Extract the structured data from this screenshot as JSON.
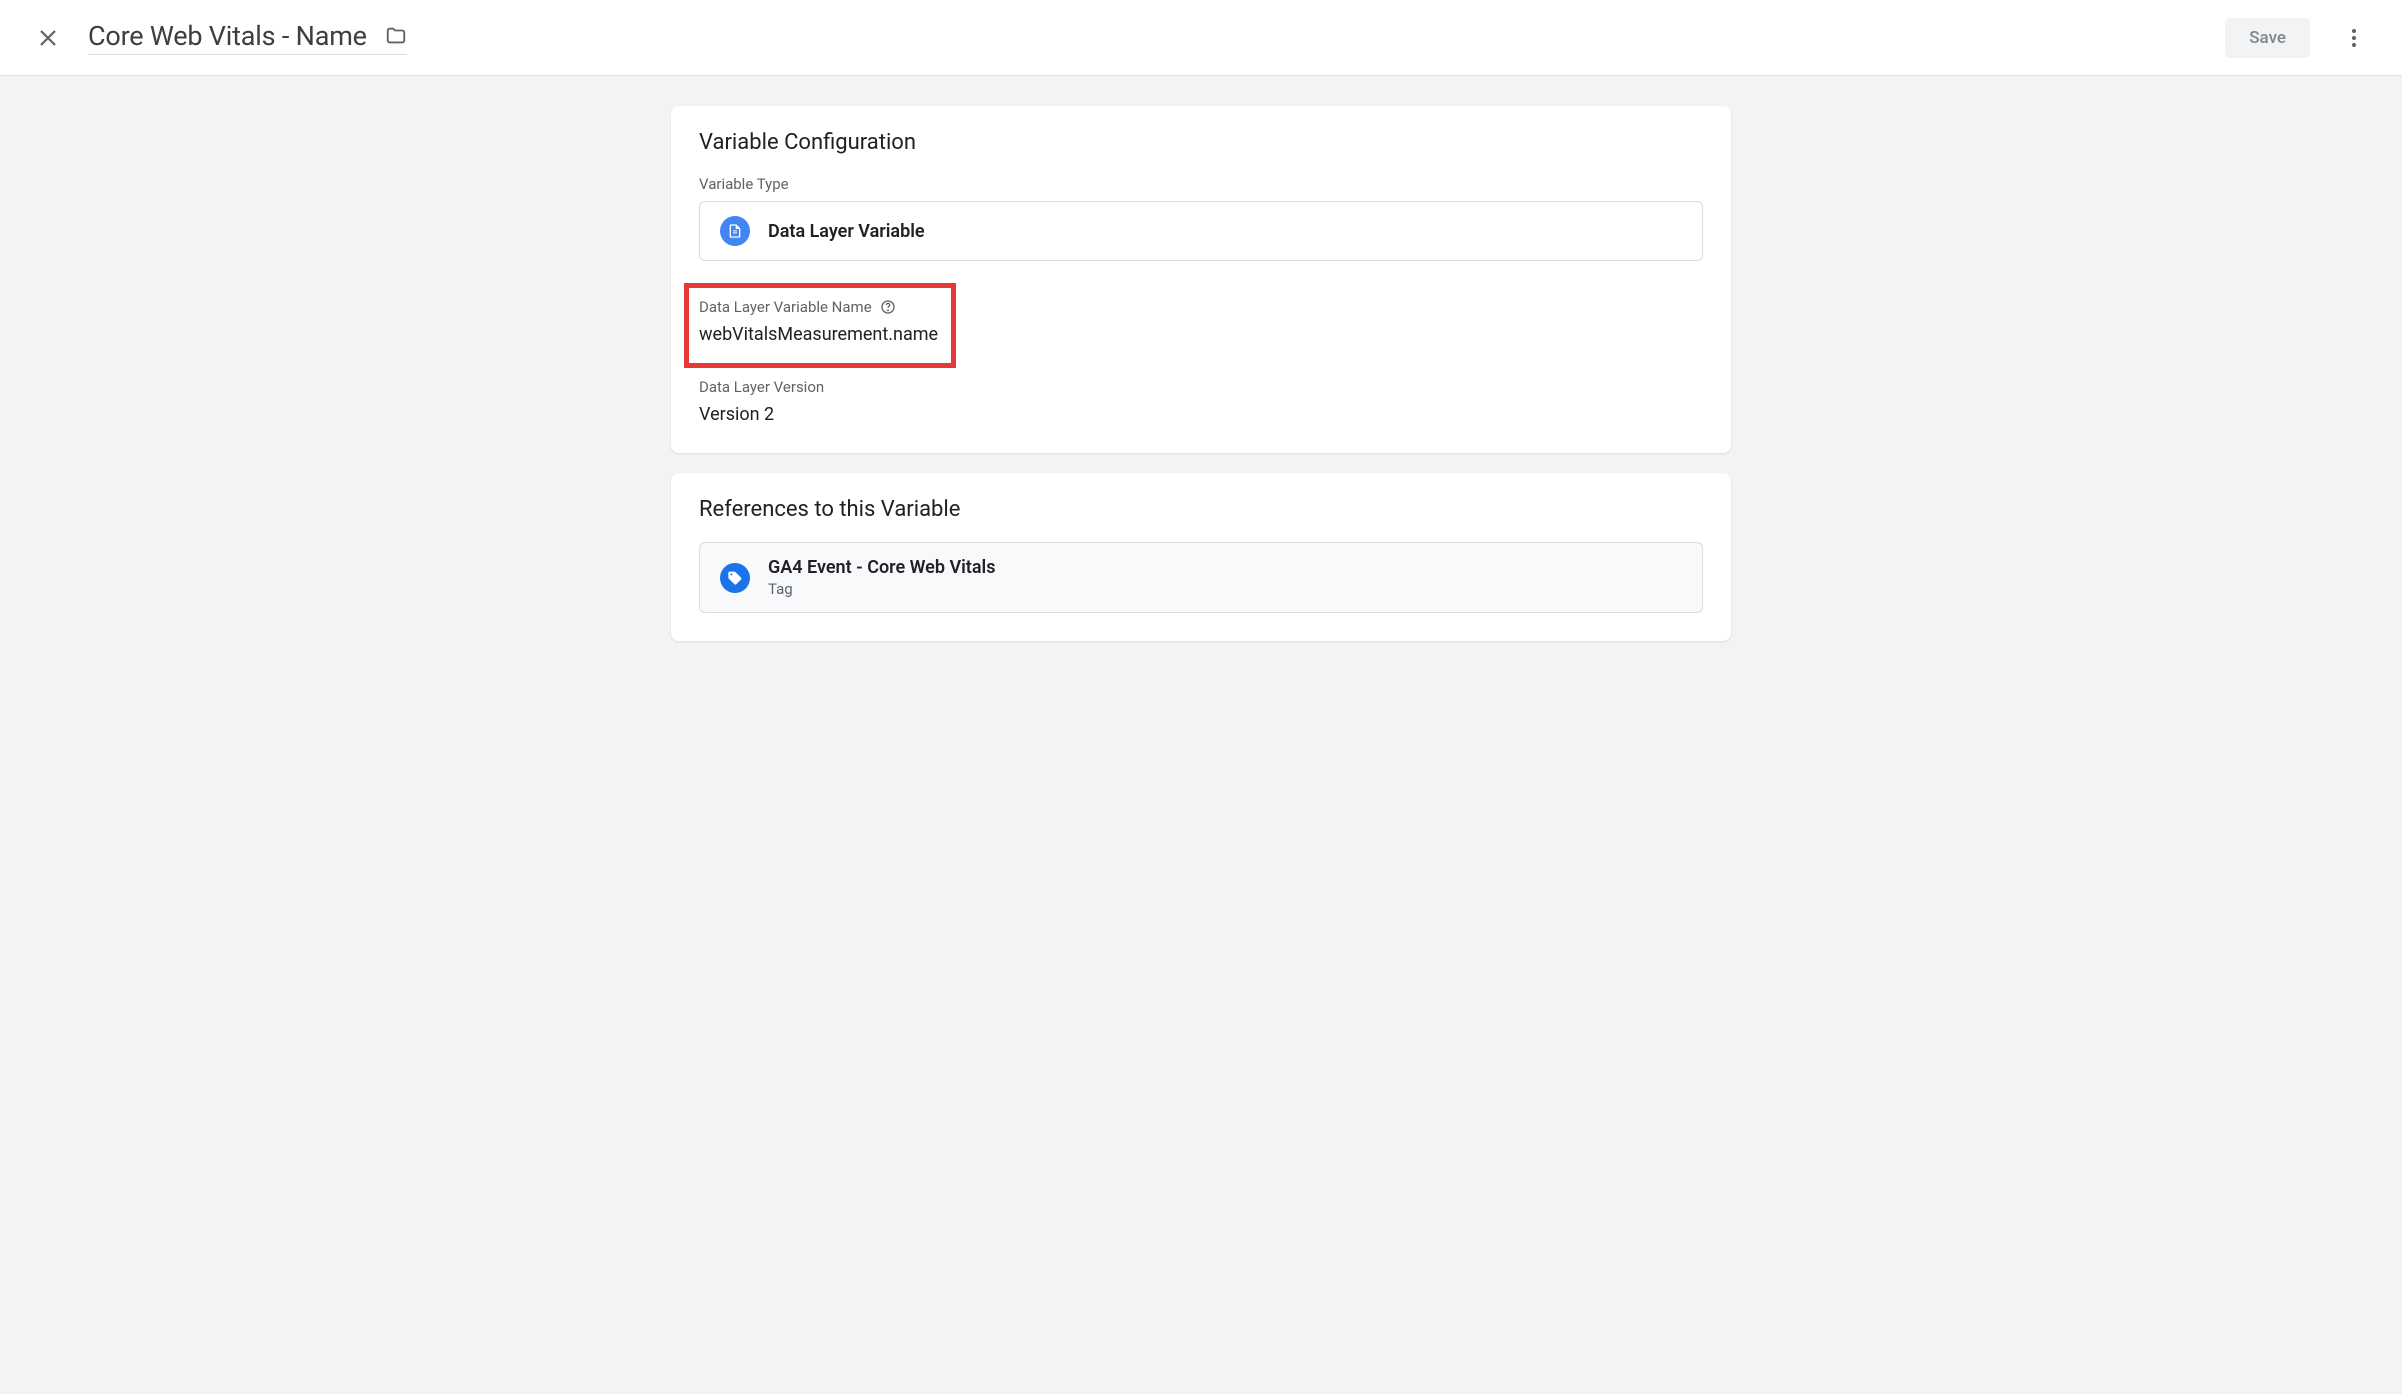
{
  "header": {
    "title": "Core Web Vitals - Name",
    "save_label": "Save"
  },
  "config": {
    "card_title": "Variable Configuration",
    "type_label": "Variable Type",
    "type_name": "Data Layer Variable",
    "var_name_label": "Data Layer Variable Name",
    "var_name_value": "webVitalsMeasurement.name",
    "version_label": "Data Layer Version",
    "version_value": "Version 2"
  },
  "references": {
    "card_title": "References to this Variable",
    "items": [
      {
        "title": "GA4 Event - Core Web Vitals",
        "sub": "Tag"
      }
    ]
  }
}
